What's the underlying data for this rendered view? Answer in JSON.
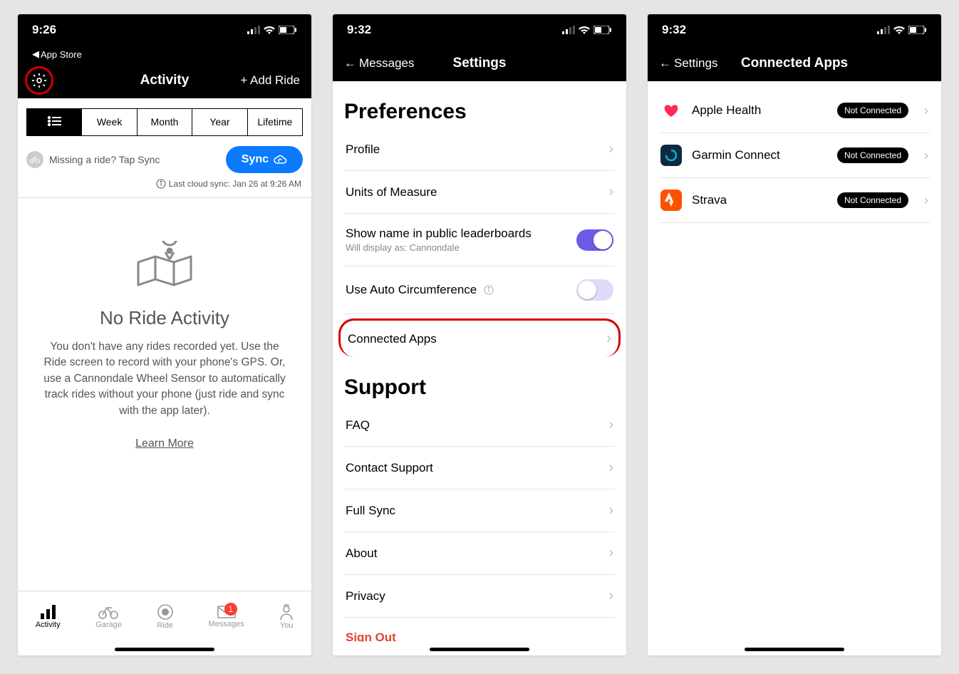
{
  "screen1": {
    "time": "9:26",
    "back_app": "App Store",
    "title": "Activity",
    "add_ride": "+ Add Ride",
    "segs": [
      "Week",
      "Month",
      "Year",
      "Lifetime"
    ],
    "sync_hint": "Missing a ride? Tap Sync",
    "sync_btn": "Sync",
    "last_sync": "Last cloud sync: Jan 26 at 9:26 AM",
    "empty_title": "No Ride Activity",
    "empty_desc": "You don't have any rides recorded yet. Use the Ride screen to record with your phone's GPS. Or, use a Cannondale Wheel Sensor to automatically track rides without your phone (just ride and sync with the app later).",
    "learn_more": "Learn More",
    "tabs": [
      "Activity",
      "Garage",
      "Ride",
      "Messages",
      "You"
    ],
    "badge_count": "1"
  },
  "screen2": {
    "time": "9:32",
    "back": "Messages",
    "title": "Settings",
    "sections": {
      "prefs_title": "Preferences",
      "profile": "Profile",
      "units": "Units of Measure",
      "leaderboard": "Show name in public leaderboards",
      "leaderboard_sub": "Will display as: Cannondale",
      "auto_circ": "Use Auto Circumference",
      "connected": "Connected Apps",
      "support_title": "Support",
      "faq": "FAQ",
      "contact": "Contact Support",
      "full_sync": "Full Sync",
      "about": "About",
      "privacy": "Privacy",
      "signout": "Sign Out"
    }
  },
  "screen3": {
    "time": "9:32",
    "back": "Settings",
    "title": "Connected Apps",
    "apps": [
      {
        "name": "Apple Health",
        "status": "Not Connected"
      },
      {
        "name": "Garmin Connect",
        "status": "Not Connected"
      },
      {
        "name": "Strava",
        "status": "Not Connected"
      }
    ]
  }
}
